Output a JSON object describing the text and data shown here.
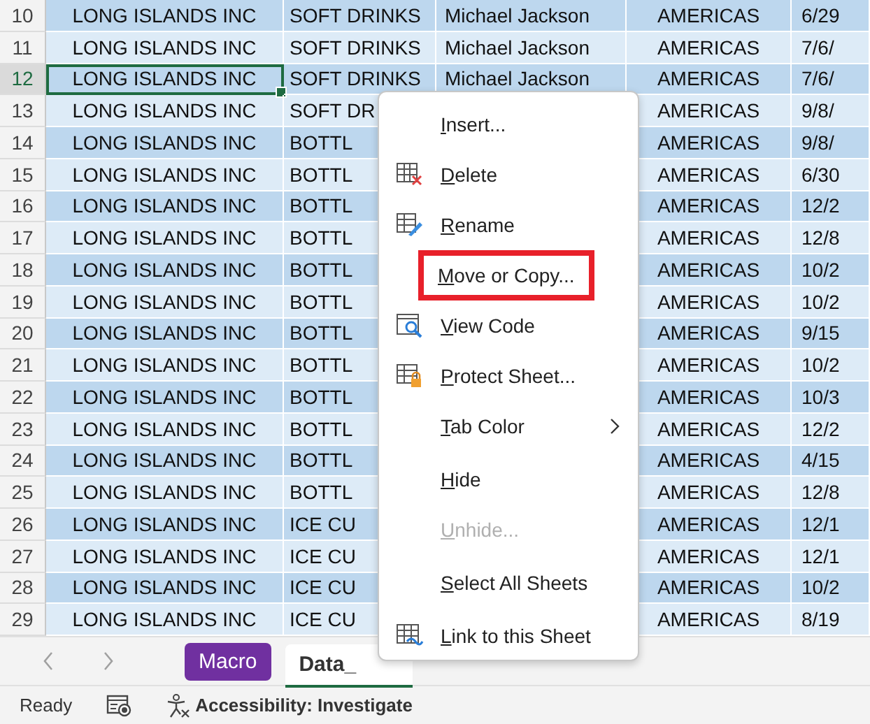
{
  "rows": [
    {
      "number": "10",
      "selected": false,
      "cells": [
        "LONG ISLANDS INC",
        "SOFT DRINKS",
        "Michael Jackson",
        "AMERICAS",
        "6/29"
      ]
    },
    {
      "number": "11",
      "selected": false,
      "cells": [
        "LONG ISLANDS INC",
        "SOFT DRINKS",
        "Michael Jackson",
        "AMERICAS",
        "7/6/"
      ]
    },
    {
      "number": "12",
      "selected": true,
      "cells": [
        "LONG ISLANDS INC",
        "SOFT DRINKS",
        "Michael Jackson",
        "AMERICAS",
        "7/6/"
      ]
    },
    {
      "number": "13",
      "selected": false,
      "cells": [
        "LONG ISLANDS INC",
        "SOFT DR",
        null,
        "AMERICAS",
        "9/8/"
      ]
    },
    {
      "number": "14",
      "selected": false,
      "cells": [
        "LONG ISLANDS INC",
        "BOTTL",
        null,
        "AMERICAS",
        "9/8/"
      ]
    },
    {
      "number": "15",
      "selected": false,
      "cells": [
        "LONG ISLANDS INC",
        "BOTTL",
        null,
        "AMERICAS",
        "6/30"
      ]
    },
    {
      "number": "16",
      "selected": false,
      "cells": [
        "LONG ISLANDS INC",
        "BOTTL",
        null,
        "AMERICAS",
        "12/2"
      ]
    },
    {
      "number": "17",
      "selected": false,
      "cells": [
        "LONG ISLANDS INC",
        "BOTTL",
        null,
        "AMERICAS",
        "12/8"
      ]
    },
    {
      "number": "18",
      "selected": false,
      "cells": [
        "LONG ISLANDS INC",
        "BOTTL",
        null,
        "AMERICAS",
        "10/2"
      ]
    },
    {
      "number": "19",
      "selected": false,
      "cells": [
        "LONG ISLANDS INC",
        "BOTTL",
        null,
        "AMERICAS",
        "10/2"
      ]
    },
    {
      "number": "20",
      "selected": false,
      "cells": [
        "LONG ISLANDS INC",
        "BOTTL",
        null,
        "AMERICAS",
        "9/15"
      ]
    },
    {
      "number": "21",
      "selected": false,
      "cells": [
        "LONG ISLANDS INC",
        "BOTTL",
        null,
        "AMERICAS",
        "10/2"
      ]
    },
    {
      "number": "22",
      "selected": false,
      "cells": [
        "LONG ISLANDS INC",
        "BOTTL",
        null,
        "AMERICAS",
        "10/3"
      ]
    },
    {
      "number": "23",
      "selected": false,
      "cells": [
        "LONG ISLANDS INC",
        "BOTTL",
        null,
        "AMERICAS",
        "12/2"
      ]
    },
    {
      "number": "24",
      "selected": false,
      "cells": [
        "LONG ISLANDS INC",
        "BOTTL",
        null,
        "AMERICAS",
        "4/15"
      ]
    },
    {
      "number": "25",
      "selected": false,
      "cells": [
        "LONG ISLANDS INC",
        "BOTTL",
        null,
        "AMERICAS",
        "12/8"
      ]
    },
    {
      "number": "26",
      "selected": false,
      "cells": [
        "LONG ISLANDS INC",
        "ICE CU",
        null,
        "AMERICAS",
        "12/1"
      ]
    },
    {
      "number": "27",
      "selected": false,
      "cells": [
        "LONG ISLANDS INC",
        "ICE CU",
        null,
        "AMERICAS",
        "12/1"
      ]
    },
    {
      "number": "28",
      "selected": false,
      "cells": [
        "LONG ISLANDS INC",
        "ICE CU",
        null,
        "AMERICAS",
        "10/2"
      ]
    },
    {
      "number": "29",
      "selected": false,
      "cells": [
        "LONG ISLANDS INC",
        "ICE CU",
        null,
        "AMERICAS",
        "8/19"
      ]
    }
  ],
  "context_menu": {
    "items": [
      {
        "kind": "item",
        "label": "Insert...",
        "highlighted": false,
        "disabled": false,
        "submenu": false
      },
      {
        "kind": "item",
        "label": "Delete",
        "highlighted": false,
        "disabled": false,
        "submenu": false
      },
      {
        "kind": "item",
        "label": "Rename",
        "highlighted": false,
        "disabled": false,
        "submenu": false
      },
      {
        "kind": "item",
        "label": "Move or Copy...",
        "highlighted": true,
        "disabled": false,
        "submenu": false
      },
      {
        "kind": "item",
        "label": "View Code",
        "highlighted": false,
        "disabled": false,
        "submenu": false
      },
      {
        "kind": "item",
        "label": "Protect Sheet...",
        "highlighted": false,
        "disabled": false,
        "submenu": false
      },
      {
        "kind": "item",
        "label": "Tab Color",
        "highlighted": false,
        "disabled": false,
        "submenu": true
      },
      {
        "kind": "separator"
      },
      {
        "kind": "item",
        "label": "Hide",
        "highlighted": false,
        "disabled": false,
        "submenu": false
      },
      {
        "kind": "item",
        "label": "Unhide...",
        "highlighted": false,
        "disabled": true,
        "submenu": false
      },
      {
        "kind": "separator"
      },
      {
        "kind": "item",
        "label": "Select All Sheets",
        "highlighted": false,
        "disabled": false,
        "submenu": false
      },
      {
        "kind": "separator"
      },
      {
        "kind": "item",
        "label": "Link to this Sheet",
        "highlighted": false,
        "disabled": false,
        "submenu": false
      }
    ]
  },
  "sheet_tabs": [
    {
      "label": "Macro",
      "selected": false,
      "color": "#7030a0"
    },
    {
      "label": "Data_",
      "selected": true
    }
  ],
  "status_bar": {
    "status": "Ready",
    "accessibility": "Accessibility: Investigate"
  }
}
